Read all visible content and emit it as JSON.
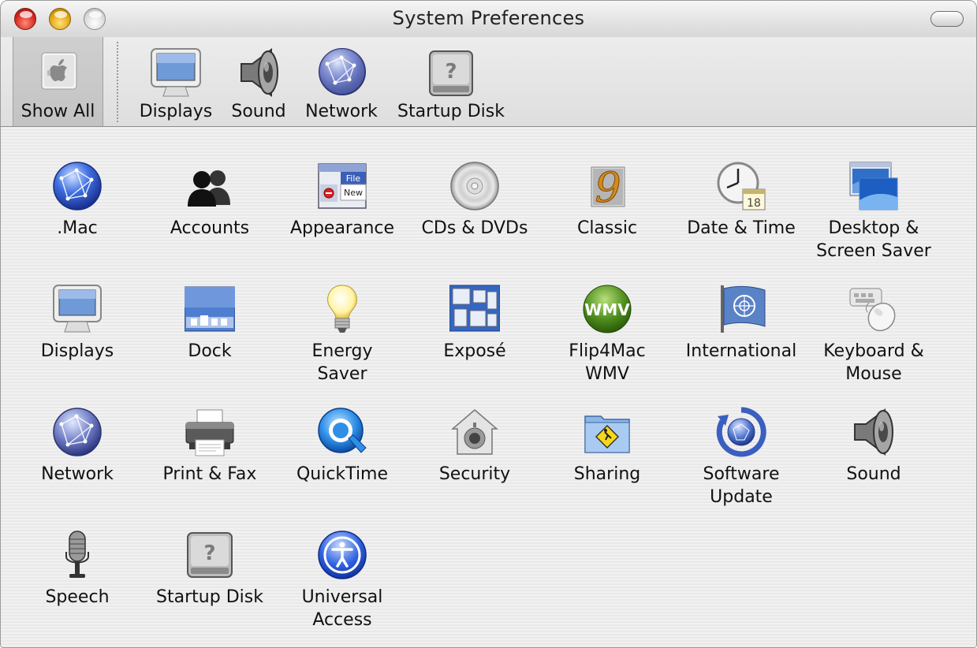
{
  "window": {
    "title": "System Preferences"
  },
  "toolbar": {
    "show_all": {
      "label": "Show All",
      "icon": "apple-icon"
    },
    "items": [
      {
        "label": "Displays",
        "icon": "display-icon"
      },
      {
        "label": "Sound",
        "icon": "speaker-icon"
      },
      {
        "label": "Network",
        "icon": "network-globe-icon"
      },
      {
        "label": "Startup Disk",
        "icon": "hard-disk-icon"
      }
    ]
  },
  "panes": [
    {
      "label": ".Mac",
      "icon": "dotmac-globe-icon"
    },
    {
      "label": "Accounts",
      "icon": "accounts-people-icon"
    },
    {
      "label": "Appearance",
      "icon": "appearance-menu-icon"
    },
    {
      "label": "CDs & DVDs",
      "icon": "disc-icon"
    },
    {
      "label": "Classic",
      "icon": "classic-nine-icon"
    },
    {
      "label": "Date & Time",
      "icon": "clock-calendar-icon",
      "badge": "18"
    },
    {
      "label": "Desktop &\nScreen Saver",
      "icon": "desktop-screensaver-icon"
    },
    {
      "label": "Displays",
      "icon": "display-icon"
    },
    {
      "label": "Dock",
      "icon": "dock-icon"
    },
    {
      "label": "Energy\nSaver",
      "icon": "light-bulb-icon"
    },
    {
      "label": "Exposé",
      "icon": "expose-windows-icon"
    },
    {
      "label": "Flip4Mac\nWMV",
      "icon": "wmv-icon",
      "badge": "WMV"
    },
    {
      "label": "International",
      "icon": "un-flag-icon"
    },
    {
      "label": "Keyboard &\nMouse",
      "icon": "keyboard-mouse-icon"
    },
    {
      "label": "Network",
      "icon": "network-globe-icon"
    },
    {
      "label": "Print & Fax",
      "icon": "printer-icon"
    },
    {
      "label": "QuickTime",
      "icon": "quicktime-icon"
    },
    {
      "label": "Security",
      "icon": "security-house-icon"
    },
    {
      "label": "Sharing",
      "icon": "sharing-folder-icon"
    },
    {
      "label": "Software\nUpdate",
      "icon": "software-update-icon"
    },
    {
      "label": "Sound",
      "icon": "speaker-icon"
    },
    {
      "label": "Speech",
      "icon": "microphone-icon"
    },
    {
      "label": "Startup Disk",
      "icon": "hard-disk-icon"
    },
    {
      "label": "Universal\nAccess",
      "icon": "universal-access-icon"
    }
  ]
}
